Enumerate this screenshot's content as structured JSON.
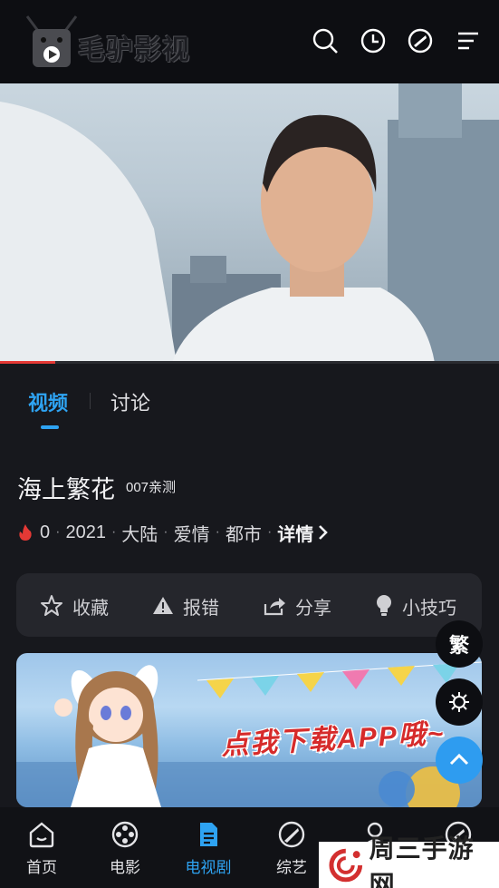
{
  "header": {
    "brand": "毛驴影视",
    "icons": [
      "search-icon",
      "history-icon",
      "explore-icon",
      "menu-icon"
    ]
  },
  "player": {
    "progress_fraction": 0.11
  },
  "tabs": [
    {
      "label": "视频",
      "active": true
    },
    {
      "label": "讨论",
      "active": false
    }
  ],
  "video": {
    "title": "海上繁花",
    "source_tag": "007亲测",
    "heat": "0",
    "year": "2021",
    "region": "大陆",
    "genre": "爱情",
    "category": "都市",
    "detail_label": "详情"
  },
  "actions": [
    {
      "icon": "star-icon",
      "label": "收藏"
    },
    {
      "icon": "warning-icon",
      "label": "报错"
    },
    {
      "icon": "share-icon",
      "label": "分享"
    },
    {
      "icon": "bulb-icon",
      "label": "小技巧"
    }
  ],
  "banner": {
    "text": "点我下载APP哦~"
  },
  "floating": {
    "traditional_label": "繁"
  },
  "nav": [
    {
      "icon": "home-icon",
      "label": "首页",
      "active": false
    },
    {
      "icon": "film-reel-icon",
      "label": "电影",
      "active": false
    },
    {
      "icon": "document-icon",
      "label": "电视剧",
      "active": true
    },
    {
      "icon": "compass-icon",
      "label": "综艺",
      "active": false
    },
    {
      "icon": "user-icon",
      "label": "",
      "active": false
    },
    {
      "icon": "compass-icon",
      "label": "",
      "active": false
    }
  ],
  "watermark": {
    "text": "周三手游网"
  },
  "colors": {
    "accent": "#2ea3f2",
    "background": "#17181d",
    "progress": "#e53935",
    "heat": "#e53935"
  }
}
